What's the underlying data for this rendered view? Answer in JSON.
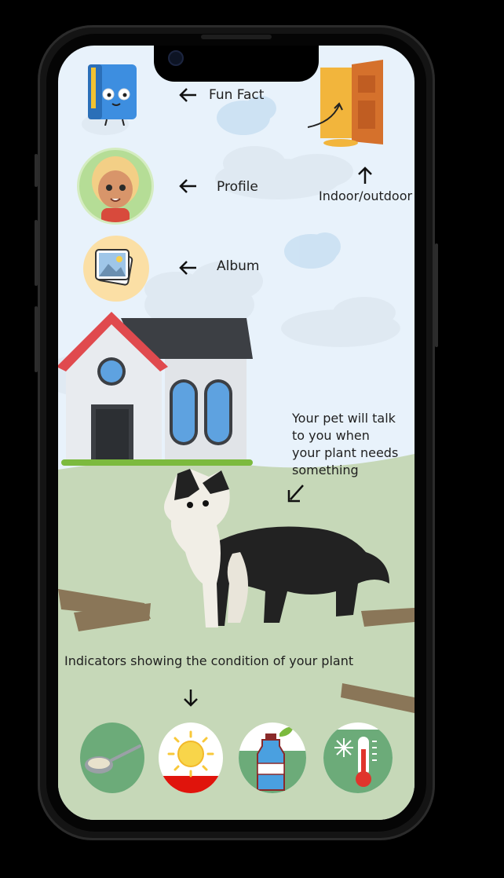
{
  "annotations": {
    "fun_fact": "Fun Fact",
    "profile": "Profile",
    "album": "Album",
    "indoor_outdoor": "Indoor/outdoor",
    "pet_talk": [
      "Your pet will talk",
      "to you when",
      "your plant needs",
      "something"
    ],
    "indicators": "Indicators showing the condition of your plant"
  },
  "icons": {
    "fun_fact": "book-mascot-icon",
    "profile": "girl-avatar-icon",
    "album": "photo-album-icon",
    "door": "door-icon",
    "food": "spoon-food-icon",
    "sun": "sun-icon",
    "water": "water-bottle-icon",
    "temperature": "thermometer-icon"
  },
  "indicator_levels": {
    "food": 1.0,
    "sun": 0.25,
    "water": 0.6,
    "temperature": 0.9
  },
  "colors": {
    "sky": "#e8f2fb",
    "grass": "#c6d8b8",
    "indicator_green": "#6cab79",
    "indicator_red": "#e0140c",
    "roof_red": "#e04a4e"
  }
}
